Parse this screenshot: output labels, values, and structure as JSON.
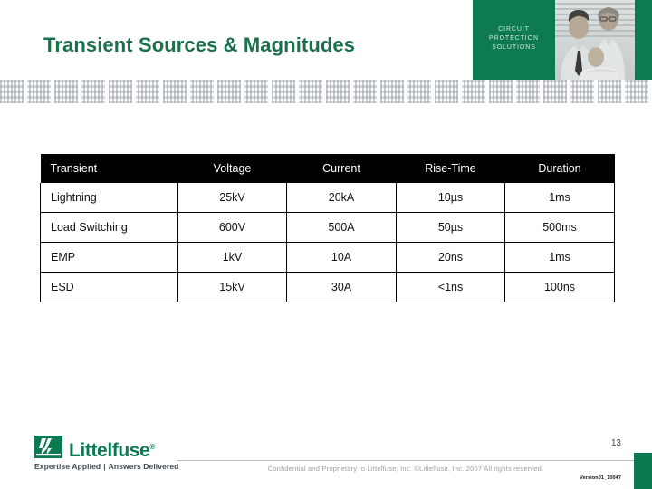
{
  "slide": {
    "title": "Transient Sources & Magnitudes",
    "page_number": "13"
  },
  "header": {
    "tagline_line1": "CIRCUIT",
    "tagline_line2": "PROTECTION",
    "tagline_line3": "SOLUTIONS",
    "brand_green": "#0d7a4f",
    "title_green": "#19704b"
  },
  "table": {
    "columns": [
      "Transient",
      "Voltage",
      "Current",
      "Rise-Time",
      "Duration"
    ],
    "rows": [
      {
        "transient": "Lightning",
        "voltage": "25kV",
        "current": "20kA",
        "rise_time": "10µs",
        "duration": "1ms"
      },
      {
        "transient": "Load Switching",
        "voltage": "600V",
        "current": "500A",
        "rise_time": "50µs",
        "duration": "500ms"
      },
      {
        "transient": "EMP",
        "voltage": "1kV",
        "current": "10A",
        "rise_time": "20ns",
        "duration": "1ms"
      },
      {
        "transient": "ESD",
        "voltage": "15kV",
        "current": "30A",
        "rise_time": "<1ns",
        "duration": "100ns"
      }
    ]
  },
  "footer": {
    "logo_word": "Littelfuse",
    "logo_reg": "®",
    "logo_tagline_left": "Expertise Applied",
    "logo_tagline_sep": "|",
    "logo_tagline_right": "Answers Delivered",
    "copyright": "Confidential and Proprietary to Littelfuse, Inc.  ©Littelfuse, Inc. 2007 All rights reserved.",
    "version": "Version01_10047"
  }
}
